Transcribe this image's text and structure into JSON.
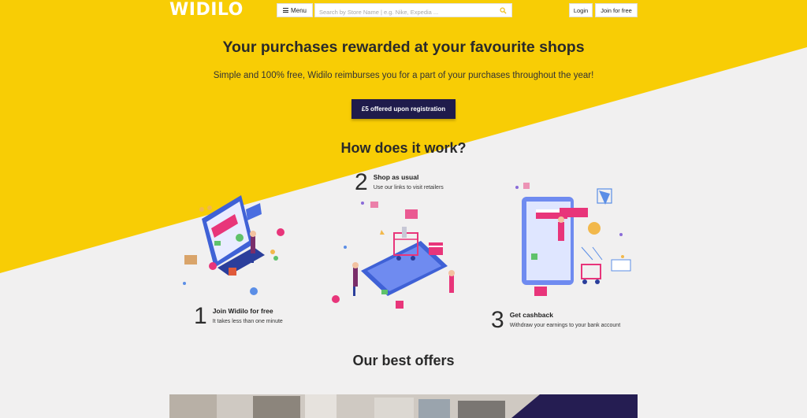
{
  "header": {
    "logo": "WIDILO",
    "menu_label": "Menu",
    "search_placeholder": "Search by Store Name | e.g. Nike, Expedia ...",
    "login_label": "Login",
    "join_label": "Join for free"
  },
  "hero": {
    "title": "Your purchases rewarded at your favourite shops",
    "subtitle": "Simple and 100% free, Widilo reimburses you for a part of your purchases throughout the year!",
    "cta_label": "£5 offered upon registration"
  },
  "how": {
    "title": "How does it work?",
    "steps": [
      {
        "num": "1",
        "title": "Join Widilo for free",
        "desc": "It takes less than one minute"
      },
      {
        "num": "2",
        "title": "Shop as usual",
        "desc": "Use our links to visit retailers"
      },
      {
        "num": "3",
        "title": "Get cashback",
        "desc": "Withdraw your earnings to your bank account"
      }
    ]
  },
  "offers": {
    "title": "Our best offers"
  },
  "colors": {
    "brand_yellow": "#f8cd05",
    "cta_navy": "#1f1b4b",
    "background": "#f1f0f0",
    "accent_pink": "#e8357a",
    "accent_blue": "#3f61d6"
  },
  "icons": [
    "menu-icon",
    "search-icon"
  ]
}
